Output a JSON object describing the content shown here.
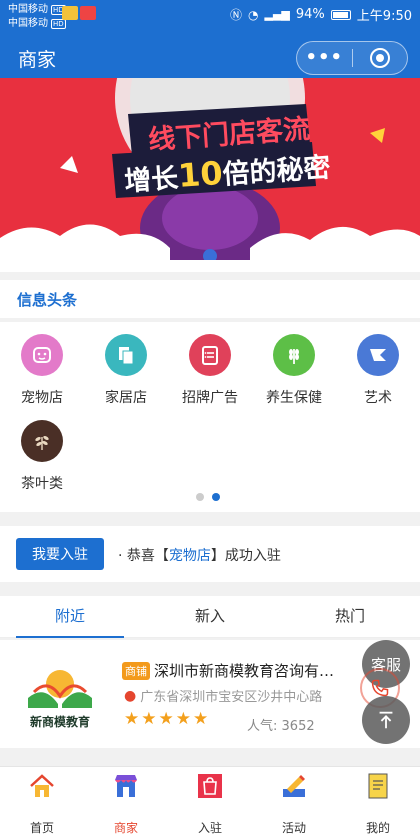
{
  "status_bar": {
    "carrier_1": "中国移动",
    "carrier_2": "中国移动",
    "hd_label": "HD",
    "battery": "94%",
    "time": "上午9:50"
  },
  "navbar": {
    "title": "商家",
    "more_icon": "more-dots-icon",
    "close_icon": "target-circle-icon"
  },
  "banner": {
    "line1": "线下门店客流",
    "line2_prefix": "增长",
    "line2_number": "10",
    "line2_suffix": "倍的秘密"
  },
  "news_section": {
    "title": "信息头条"
  },
  "categories": [
    {
      "label": "宠物店",
      "icon": "pet-face-icon",
      "color": "#e37ac9"
    },
    {
      "label": "家居店",
      "icon": "copy-pages-icon",
      "color": "#3ab7be"
    },
    {
      "label": "招牌广告",
      "icon": "clipboard-list-icon",
      "color": "#e0415a"
    },
    {
      "label": "养生保健",
      "icon": "wheat-icon",
      "color": "#5dbf47"
    },
    {
      "label": "艺术",
      "icon": "flag-icon",
      "color": "#4a79d6"
    },
    {
      "label": "茶叶类",
      "icon": "tea-plant-icon",
      "color": "#4a2f26"
    }
  ],
  "carousel_dots": {
    "count": 2,
    "active": 1
  },
  "join": {
    "button_label": "我要入驻",
    "notice_prefix": "· 恭喜【",
    "notice_shop": "宠物店",
    "notice_suffix": "】成功入驻"
  },
  "tabs": [
    {
      "label": "附近",
      "active": true
    },
    {
      "label": "新入",
      "active": false
    },
    {
      "label": "热门",
      "active": false
    }
  ],
  "shop": {
    "logo_text": "新商模教育",
    "badge": "商铺",
    "name": "深圳市新商模教育咨询有限公司",
    "address": "广东省深圳市宝安区沙井中心路",
    "rating": 5,
    "popularity_label": "人气:",
    "popularity_value": "3652"
  },
  "float_buttons": {
    "service": "客服",
    "phone_icon": "phone-icon",
    "top_icon": "arrow-up-icon"
  },
  "tab_bar": [
    {
      "label": "首页",
      "icon": "home-icon",
      "active": false
    },
    {
      "label": "商家",
      "icon": "shop-icon",
      "active": true
    },
    {
      "label": "入驻",
      "icon": "shopping-bag-icon",
      "active": false
    },
    {
      "label": "活动",
      "icon": "activity-pencil-icon",
      "active": false
    },
    {
      "label": "我的",
      "icon": "profile-icon",
      "active": false
    }
  ],
  "colors": {
    "primary": "#1d6fd0",
    "banner_red": "#e8303f",
    "accent": "#e5462f",
    "star": "#f3a01d"
  }
}
